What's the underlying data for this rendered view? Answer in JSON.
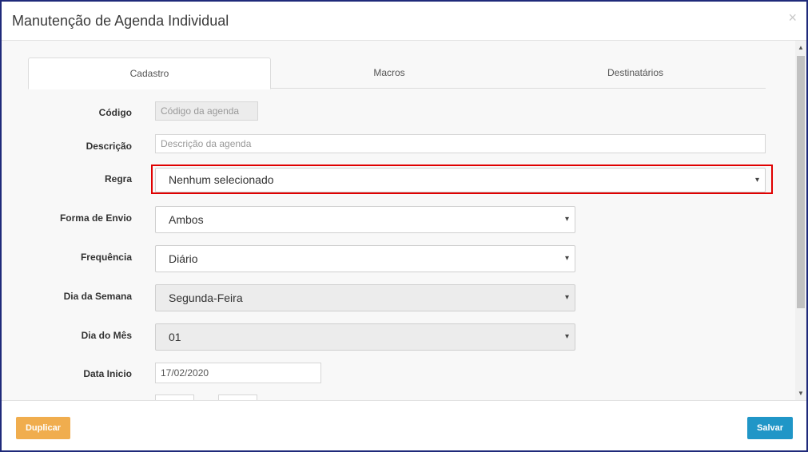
{
  "modal": {
    "title": "Manutenção de Agenda Individual",
    "close_symbol": "×"
  },
  "tabs": [
    {
      "label": "Cadastro",
      "active": true
    },
    {
      "label": "Macros",
      "active": false
    },
    {
      "label": "Destinatários",
      "active": false
    }
  ],
  "form": {
    "codigo": {
      "label": "Código",
      "placeholder": "Código da agenda",
      "value": ""
    },
    "descricao": {
      "label": "Descrição",
      "placeholder": "Descrição da agenda",
      "value": ""
    },
    "regra": {
      "label": "Regra",
      "value": "Nenhum selecionado"
    },
    "forma_envio": {
      "label": "Forma de Envio",
      "value": "Ambos"
    },
    "frequencia": {
      "label": "Frequência",
      "value": "Diário"
    },
    "dia_semana": {
      "label": "Dia da Semana",
      "value": "Segunda-Feira"
    },
    "dia_mes": {
      "label": "Dia do Mês",
      "value": "01"
    },
    "data_inicio": {
      "label": "Data Inicio",
      "value": "17/02/2020"
    }
  },
  "buttons": {
    "duplicar": "Duplicar",
    "salvar": "Salvar"
  },
  "colors": {
    "highlight": "#e00000",
    "duplicar_bg": "#f0ad4e",
    "salvar_bg": "#2096c7"
  },
  "icons": {
    "caret": "▾",
    "scroll_up": "▲",
    "scroll_down": "▼"
  }
}
